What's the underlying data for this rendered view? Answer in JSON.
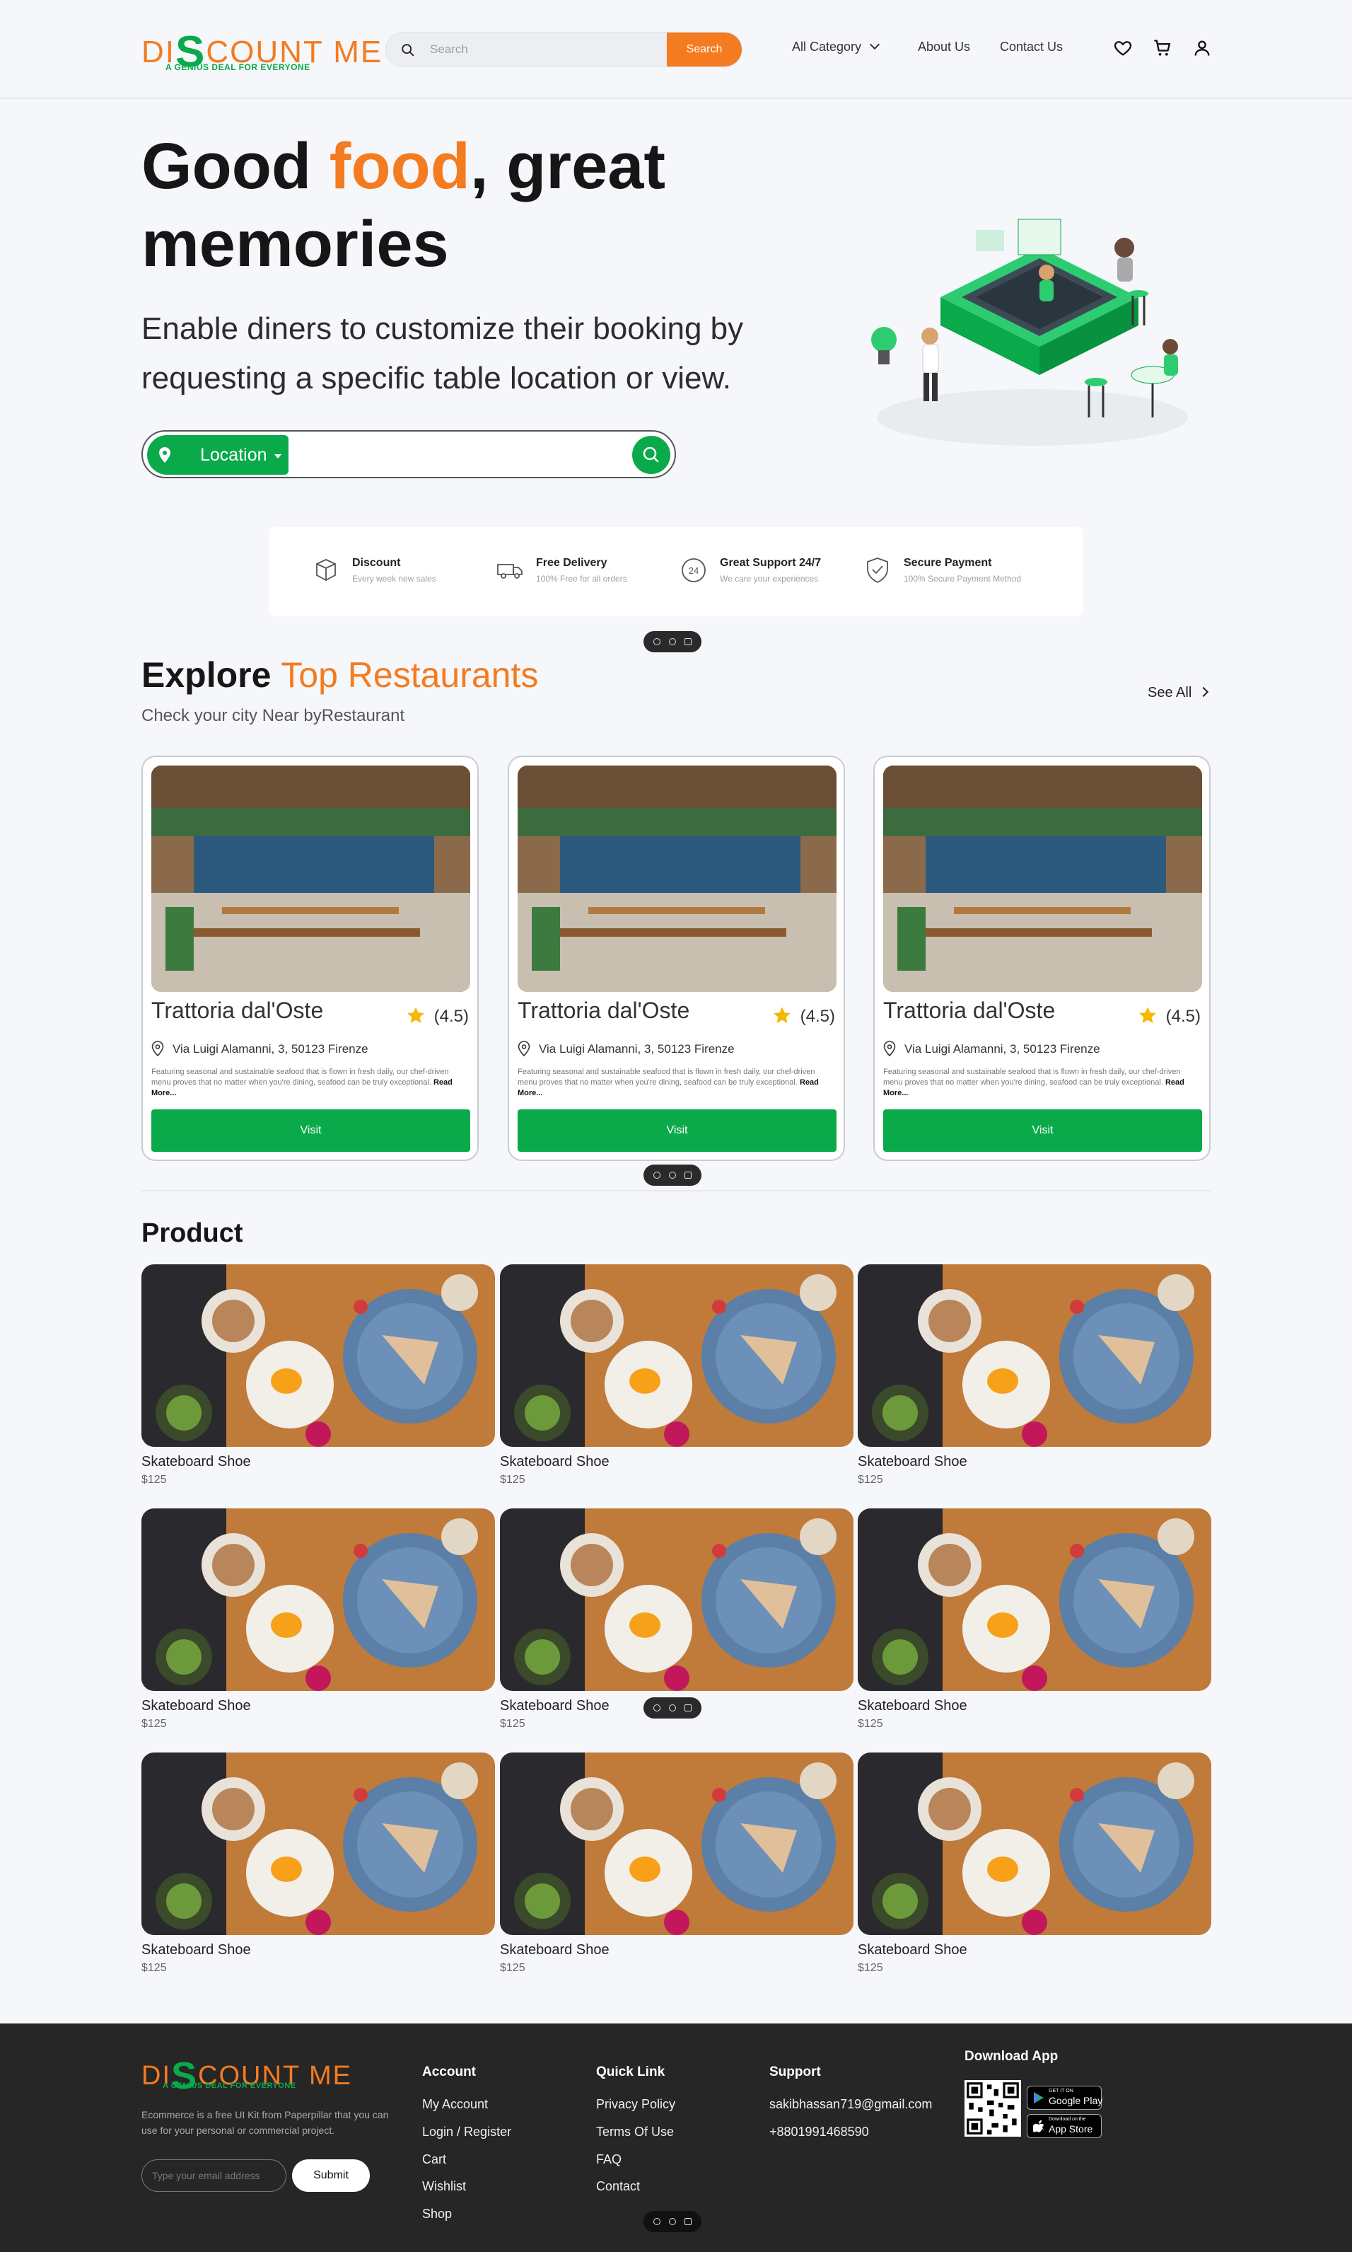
{
  "header": {
    "logo_text_pre": "DI",
    "logo_text_s": "S",
    "logo_text_post": "COUNT ME",
    "logo_tagline": "A GENIUS DEAL FOR EVERYONE",
    "search_placeholder": "Search",
    "search_button": "Search",
    "nav": [
      "All Category",
      "About Us",
      "Contact Us"
    ],
    "icons": [
      "heart-icon",
      "cart-icon",
      "user-icon"
    ]
  },
  "hero": {
    "title_pre": "Good ",
    "title_accent": "food",
    "title_post": ", great memories",
    "subtitle": "Enable diners to customize their booking by requesting a specific table location or view.",
    "location_label": "Location"
  },
  "features": [
    {
      "icon": "box-icon",
      "title": "Discount",
      "desc": "Every week new sales"
    },
    {
      "icon": "truck-icon",
      "title": "Free Delivery",
      "desc": "100% Free for all orders"
    },
    {
      "icon": "support-24-icon",
      "title": "Great Support 24/7",
      "desc": "We care your experiences"
    },
    {
      "icon": "shield-check-icon",
      "title": "Secure Payment",
      "desc": "100% Secure Payment Method"
    }
  ],
  "explore": {
    "title_pre": "Explore ",
    "title_accent": "Top Restaurants",
    "subtitle": "Check your city Near byRestaurant",
    "see_all": "See All",
    "cards": [
      {
        "name": "Trattoria dal'Oste",
        "rating": "(4.5)",
        "address": "Via Luigi Alamanni, 3, 50123 Firenze",
        "desc": "Featuring seasonal and sustainable seafood that is flown in fresh daily, our chef-driven menu proves that no matter when you're dining, seafood can be truly exceptional.",
        "read_more": "Read More...",
        "button": "Visit"
      },
      {
        "name": "Trattoria dal'Oste",
        "rating": "(4.5)",
        "address": "Via Luigi Alamanni, 3, 50123 Firenze",
        "desc": "Featuring seasonal and sustainable seafood that is flown in fresh daily, our chef-driven menu proves that no matter when you're dining, seafood can be truly exceptional.",
        "read_more": "Read More...",
        "button": "Visit"
      },
      {
        "name": "Trattoria dal'Oste",
        "rating": "(4.5)",
        "address": "Via Luigi Alamanni, 3, 50123 Firenze",
        "desc": "Featuring seasonal and sustainable seafood that is flown in fresh daily, our chef-driven menu proves that no matter when you're dining, seafood can be truly exceptional.",
        "read_more": "Read More...",
        "button": "Visit"
      }
    ]
  },
  "products": {
    "title": "Product",
    "items": [
      {
        "name": "Skateboard Shoe",
        "price": "$125"
      },
      {
        "name": "Skateboard Shoe",
        "price": "$125"
      },
      {
        "name": "Skateboard Shoe",
        "price": "$125"
      },
      {
        "name": "Skateboard Shoe",
        "price": "$125"
      },
      {
        "name": "Skateboard Shoe",
        "price": "$125"
      },
      {
        "name": "Skateboard Shoe",
        "price": "$125"
      },
      {
        "name": "Skateboard Shoe",
        "price": "$125"
      },
      {
        "name": "Skateboard Shoe",
        "price": "$125"
      },
      {
        "name": "Skateboard Shoe",
        "price": "$125"
      }
    ]
  },
  "footer": {
    "description": "Ecommerce is a free UI Kit from Paperpillar that you can use for your personal or commercial project.",
    "email_placeholder": "Type your email address",
    "submit": "Submit",
    "account": {
      "title": "Account",
      "links": [
        "My Account",
        "Login / Register",
        "Cart",
        "Wishlist",
        "Shop"
      ]
    },
    "quick": {
      "title": "Quick Link",
      "links": [
        "Privacy Policy",
        "Terms Of Use",
        "FAQ",
        "Contact"
      ]
    },
    "support": {
      "title": "Support",
      "links": [
        "sakibhassan719@gmail.com",
        "+8801991468590"
      ]
    },
    "download": {
      "title": "Download App",
      "google_small": "GET IT ON",
      "google_big": "Google Play",
      "apple_small": "Download on the",
      "apple_big": "App Store"
    }
  },
  "colors": {
    "accent": "#f47b20",
    "brand_green": "#0aaa4b",
    "footer_bg": "#262626"
  }
}
